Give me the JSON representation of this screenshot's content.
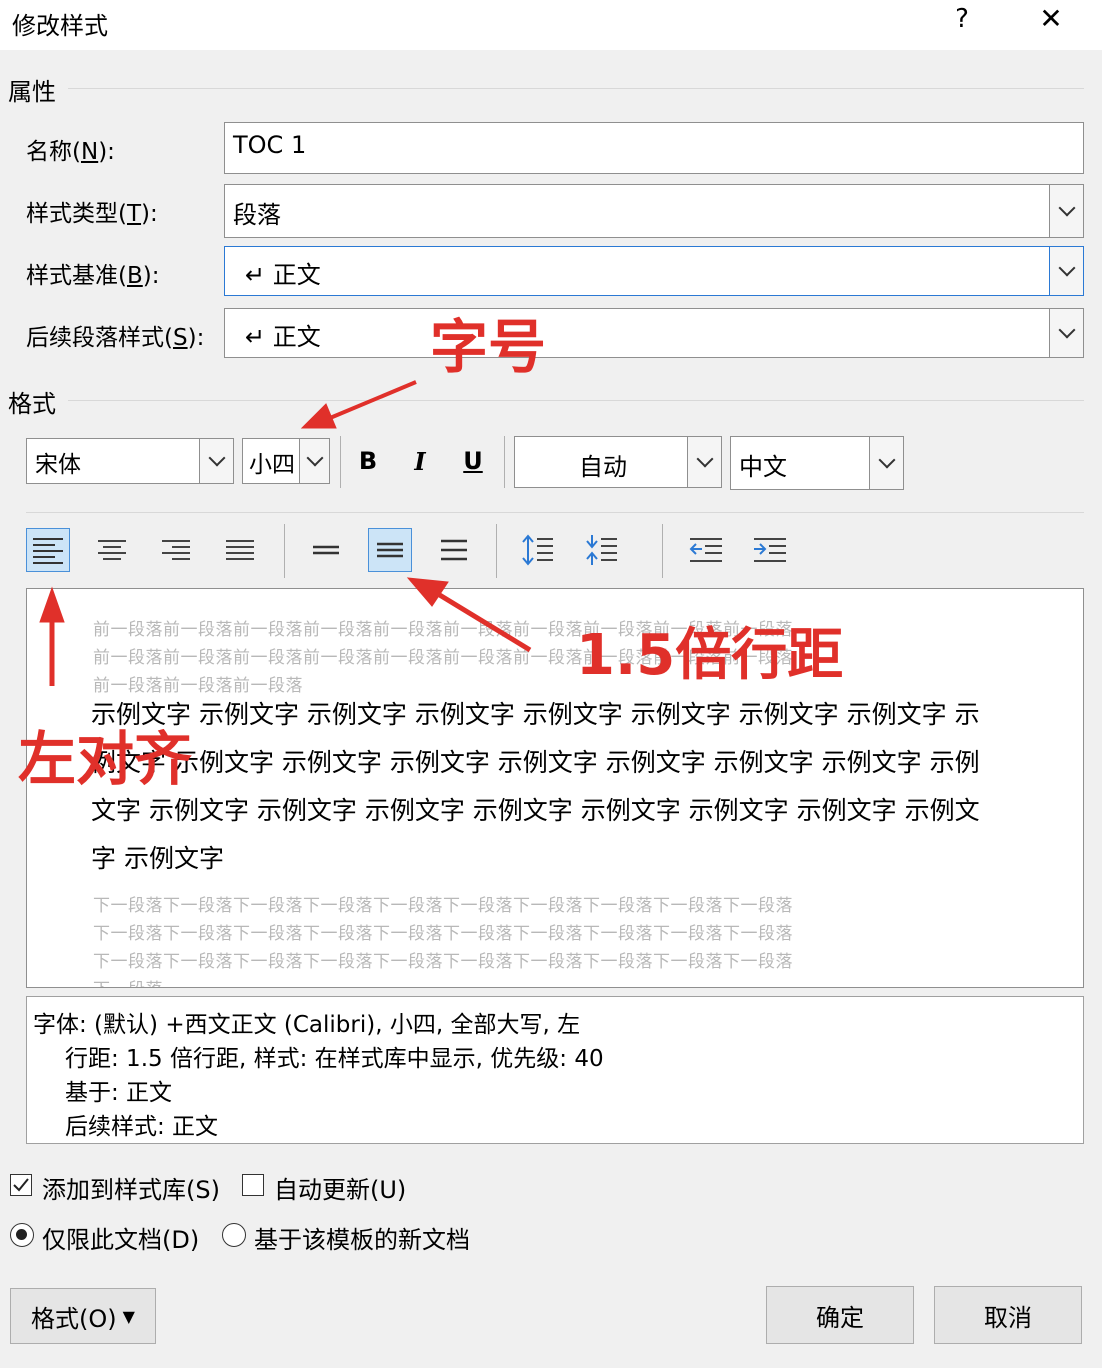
{
  "window": {
    "title": "修改样式",
    "help": "?",
    "close": "✕"
  },
  "properties": {
    "section_label": "属性",
    "name_label": "名称(",
    "name_key": "N",
    "name_label_end": "):",
    "name_value": "TOC 1",
    "type_label": "样式类型(",
    "type_key": "T",
    "type_label_end": "):",
    "type_value": "段落",
    "based_label": "样式基准(",
    "based_key": "B",
    "based_label_end": "):",
    "based_value": "↵ 正文",
    "next_label": "后续段落样式(",
    "next_key": "S",
    "next_label_end": "):",
    "next_value": "↵ 正文"
  },
  "format": {
    "section_label": "格式",
    "font": "宋体",
    "size": "小四",
    "bold": "B",
    "italic": "I",
    "underline": "U",
    "color": "自动",
    "script": "中文"
  },
  "preview": {
    "prev_lines": [
      "前一段落前一段落前一段落前一段落前一段落前一段落前一段落前一段落前一段落前一段落",
      "前一段落前一段落前一段落前一段落前一段落前一段落前一段落前一段落前一段落前一段落",
      "前一段落前一段落前一段落"
    ],
    "main_lines": [
      "示例文字 示例文字 示例文字 示例文字 示例文字 示例文字 示例文字 示例文字 示",
      "例文字 示例文字 示例文字 示例文字 示例文字 示例文字 示例文字 示例文字 示例",
      "文字 示例文字 示例文字 示例文字 示例文字 示例文字 示例文字 示例文字 示例文",
      "字 示例文字"
    ],
    "next_lines": [
      "下一段落下一段落下一段落下一段落下一段落下一段落下一段落下一段落下一段落下一段落",
      "下一段落下一段落下一段落下一段落下一段落下一段落下一段落下一段落下一段落下一段落",
      "下一段落下一段落下一段落下一段落下一段落下一段落下一段落下一段落下一段落下一段落",
      "下一段落"
    ]
  },
  "description": {
    "line1": "字体: (默认) +西文正文 (Calibri), 小四, 全部大写, 左",
    "line2": "行距: 1.5 倍行距, 样式: 在样式库中显示, 优先级: 40",
    "line3": "基于: 正文",
    "line4": "后续样式: 正文"
  },
  "options": {
    "add_to_gallery": "添加到样式库(S)",
    "add_to_gallery_checked": true,
    "auto_update": "自动更新(U)",
    "auto_update_checked": false,
    "this_doc_only": "仅限此文档(D)",
    "this_doc_only_selected": true,
    "new_docs": "基于该模板的新文档",
    "new_docs_selected": false
  },
  "buttons": {
    "format": "格式(O)",
    "ok": "确定",
    "cancel": "取消"
  },
  "annotations": {
    "font_size": "字号",
    "line_spacing": "1.5倍行距",
    "left_align": "左对齐",
    "color": "#e0302a"
  }
}
